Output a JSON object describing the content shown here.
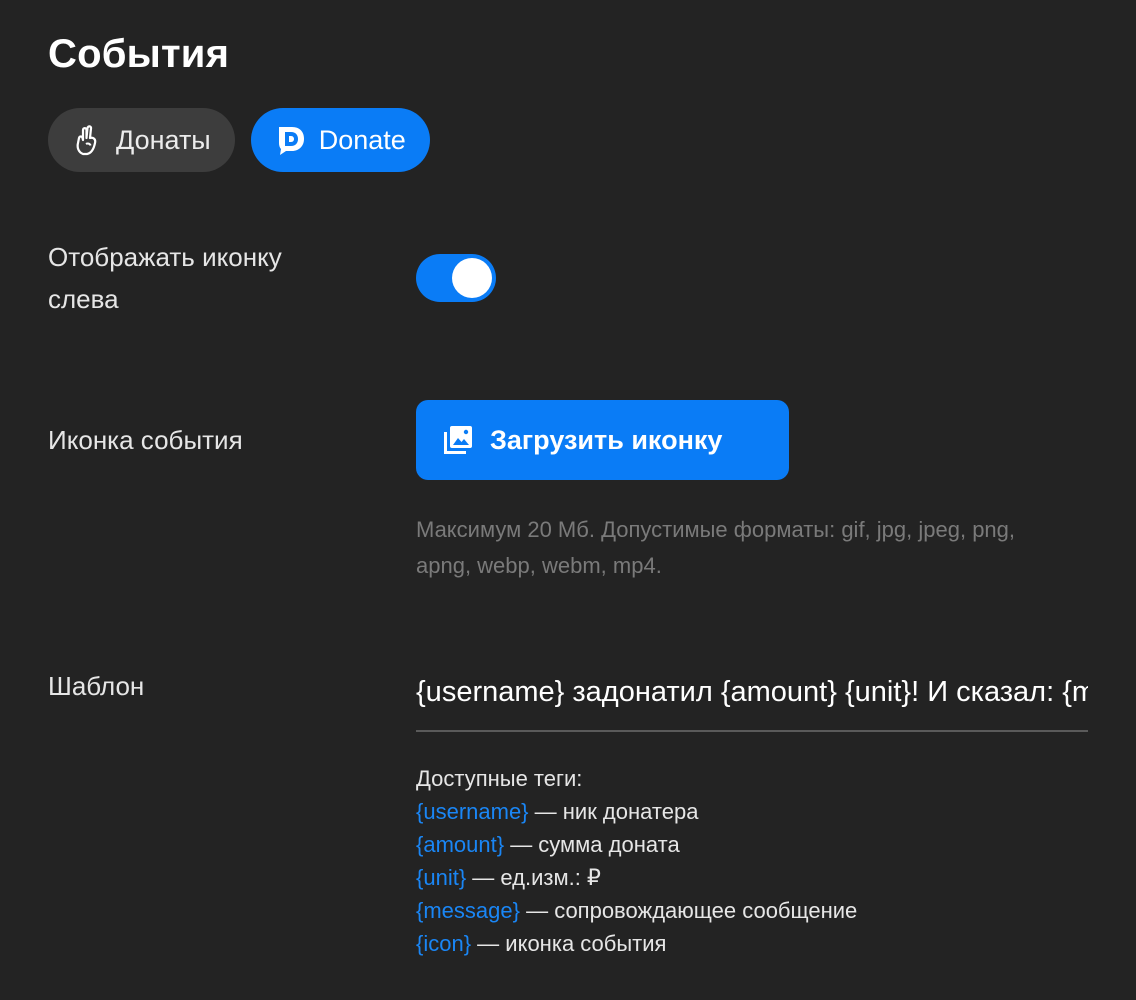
{
  "page": {
    "title": "События"
  },
  "tabs": [
    {
      "label": "Донаты",
      "icon": "hand-icon",
      "active": false
    },
    {
      "label": "Donate",
      "icon": "donate-logo-icon",
      "active": true
    }
  ],
  "settings": {
    "show_icon_left": {
      "label_line1": "Отображать иконку",
      "label_line2": "слева",
      "enabled": true
    },
    "event_icon": {
      "label": "Иконка события",
      "button_label": "Загрузить иконку",
      "button_icon": "image-icon",
      "hint_line1": "Максимум 20 Мб. Допустимые форматы: gif, jpg, jpeg, png,",
      "hint_line2": "apng, webp, webm, mp4."
    },
    "template": {
      "label": "Шаблон",
      "value": "{username} задонатил {amount} {unit}! И сказал: {message}"
    }
  },
  "tags": {
    "heading": "Доступные теги:",
    "items": [
      {
        "tag": "{username}",
        "desc": " — ник донатера"
      },
      {
        "tag": "{amount}",
        "desc": " — сумма доната"
      },
      {
        "tag": "{unit}",
        "desc": " — ед.изм.: ₽"
      },
      {
        "tag": "{message}",
        "desc": " — сопровождающее сообщение"
      },
      {
        "tag": "{icon}",
        "desc": " — иконка события"
      }
    ]
  },
  "colors": {
    "background": "#232323",
    "accent": "#0a7cf6",
    "tag_color": "#1a86f5",
    "hint_color": "#7a7a7a"
  }
}
